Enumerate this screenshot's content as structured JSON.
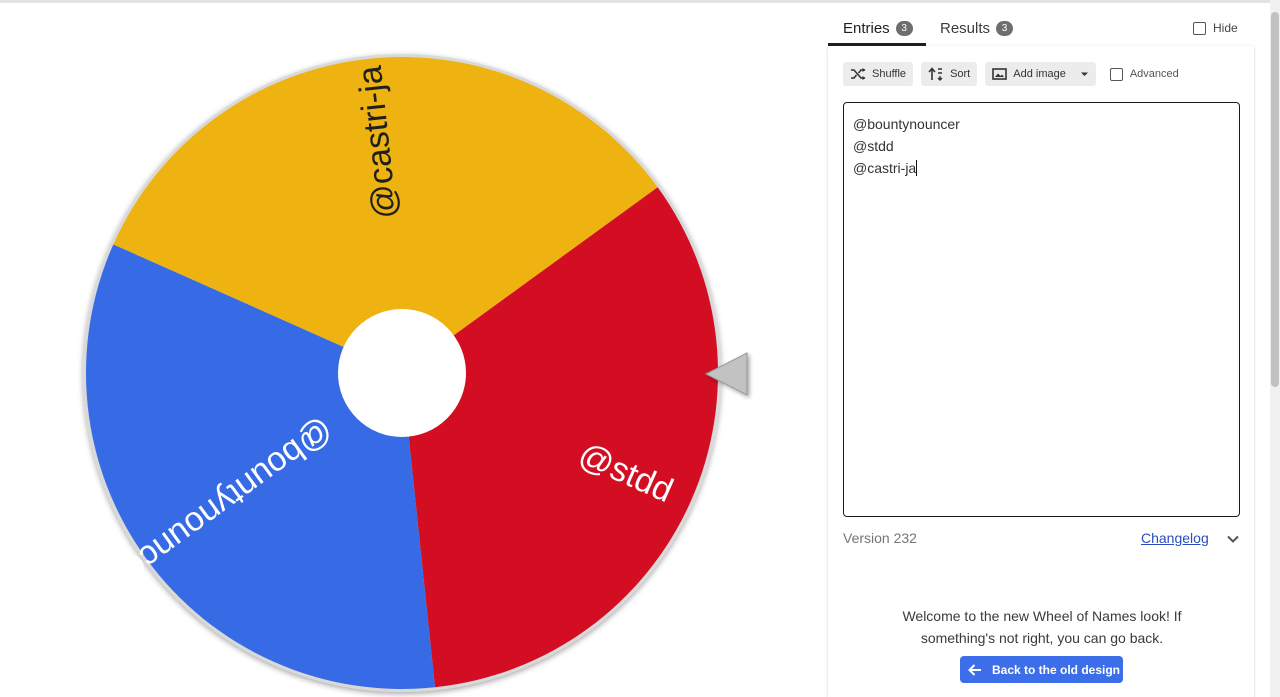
{
  "wheel": {
    "colors": [
      "#eeb311",
      "#d30e22",
      "#376be6"
    ],
    "segments": [
      {
        "label": "@castri-ja",
        "color": "#eeb311"
      },
      {
        "label": "@stdd",
        "color": "#d30e22"
      },
      {
        "label": "@bountynouncer",
        "color": "#376be6"
      }
    ],
    "pointer_icon": "triangle-pointer-icon"
  },
  "tabs": {
    "entries": {
      "label": "Entries",
      "count": "3"
    },
    "results": {
      "label": "Results",
      "count": "3"
    }
  },
  "hide_label": "Hide",
  "toolbar": {
    "shuffle": "Shuffle",
    "sort": "Sort",
    "add_image": "Add image",
    "advanced": "Advanced"
  },
  "entries": [
    "@bountynouncer",
    "@stdd",
    "@castri-ja"
  ],
  "footer": {
    "version": "Version 232",
    "changelog": "Changelog"
  },
  "welcome": {
    "line1": "Welcome to the new Wheel of Names look! If",
    "line2": "something's not right, you can go back.",
    "back_button": "Back to the old design"
  },
  "accent_color": "#3b6ee8"
}
